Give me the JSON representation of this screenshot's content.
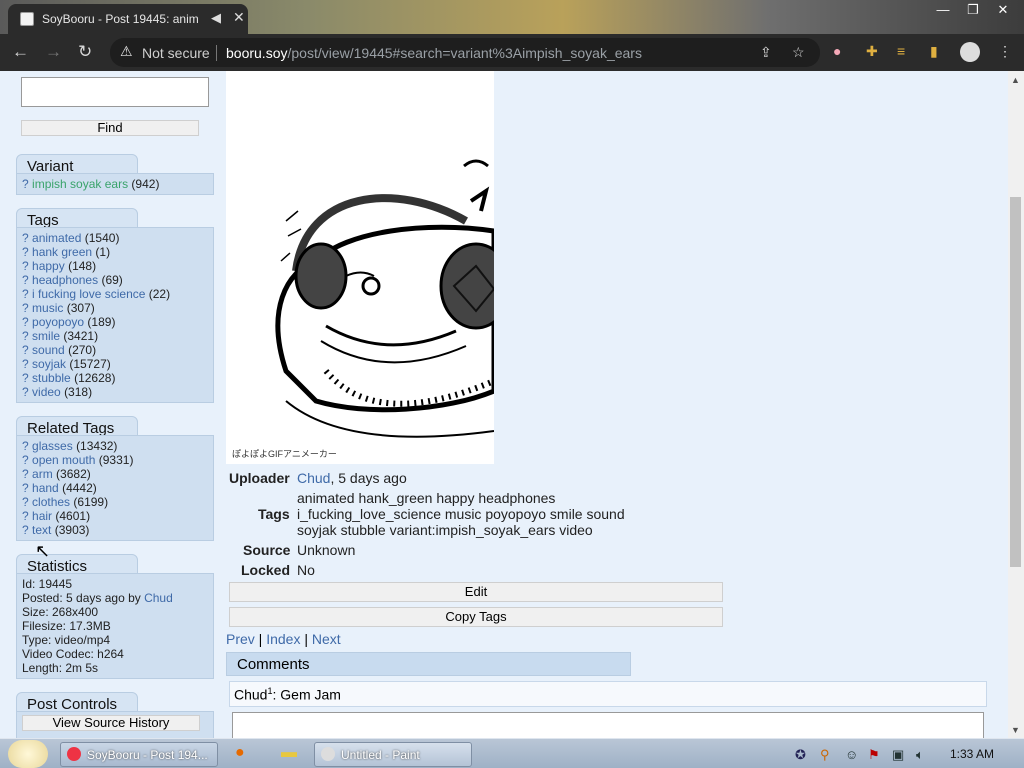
{
  "browser": {
    "tab_title": "SoyBooru - Post 19445: anim",
    "not_secure": "Not secure",
    "url_host": "booru.soy",
    "url_path": "/post/view/19445#search=variant%3Aimpish_soyak_ears"
  },
  "sidebar": {
    "find_label": "Find",
    "search_value": "",
    "variant": {
      "title": "Variant",
      "items": [
        {
          "q": "?",
          "name": "impish soyak ears",
          "count": "(942)"
        }
      ]
    },
    "tags": {
      "title": "Tags",
      "items": [
        {
          "q": "?",
          "name": "animated",
          "count": "(1540)"
        },
        {
          "q": "?",
          "name": "hank green",
          "count": "(1)"
        },
        {
          "q": "?",
          "name": "happy",
          "count": "(148)"
        },
        {
          "q": "?",
          "name": "headphones",
          "count": "(69)"
        },
        {
          "q": "?",
          "name": "i fucking love science",
          "count": "(22)"
        },
        {
          "q": "?",
          "name": "music",
          "count": "(307)"
        },
        {
          "q": "?",
          "name": "poyopoyo",
          "count": "(189)"
        },
        {
          "q": "?",
          "name": "smile",
          "count": "(3421)"
        },
        {
          "q": "?",
          "name": "sound",
          "count": "(270)"
        },
        {
          "q": "?",
          "name": "soyjak",
          "count": "(15727)"
        },
        {
          "q": "?",
          "name": "stubble",
          "count": "(12628)"
        },
        {
          "q": "?",
          "name": "video",
          "count": "(318)"
        }
      ]
    },
    "related": {
      "title": "Related Tags",
      "items": [
        {
          "q": "?",
          "name": "glasses",
          "count": "(13432)"
        },
        {
          "q": "?",
          "name": "open mouth",
          "count": "(9331)"
        },
        {
          "q": "?",
          "name": "arm",
          "count": "(3682)"
        },
        {
          "q": "?",
          "name": "hand",
          "count": "(4442)"
        },
        {
          "q": "?",
          "name": "clothes",
          "count": "(6199)"
        },
        {
          "q": "?",
          "name": "hair",
          "count": "(4601)"
        },
        {
          "q": "?",
          "name": "text",
          "count": "(3903)"
        }
      ]
    },
    "stats": {
      "title": "Statistics",
      "id": "Id: 19445",
      "posted_prefix": "Posted: 5 days ago by ",
      "posted_user": "Chud",
      "size": "Size: 268x400",
      "filesize": "Filesize: 17.3MB",
      "type": "Type: video/mp4",
      "codec": "Video Codec: h264",
      "length": "Length: 2m 5s"
    },
    "controls": {
      "title": "Post Controls",
      "history_btn": "View Source History"
    }
  },
  "post": {
    "image_caption": "ぽよぽよGIFアニメーカー",
    "uploader_label": "Uploader",
    "uploader_name": "Chud",
    "uploader_time": ", 5 days ago",
    "tags_label": "Tags",
    "tags_line1": "animated hank_green happy headphones",
    "tags_line2": "i_fucking_love_science music poyopoyo smile sound",
    "tags_line3": "soyjak stubble variant:impish_soyak_ears video",
    "source_label": "Source",
    "source_value": "Unknown",
    "locked_label": "Locked",
    "locked_value": "No",
    "edit_btn": "Edit",
    "copy_btn": "Copy Tags",
    "prev": "Prev",
    "sep1": " | ",
    "index": "Index",
    "sep2": " | ",
    "next": "Next",
    "comments_title": "Comments",
    "comment_user": "Chud",
    "comment_sup": "1",
    "comment_text": ": Gem Jam"
  },
  "taskbar": {
    "task1": "SoyBooru - Post 194...",
    "task2": "Untitled - Paint",
    "clock": "1:33 AM"
  }
}
